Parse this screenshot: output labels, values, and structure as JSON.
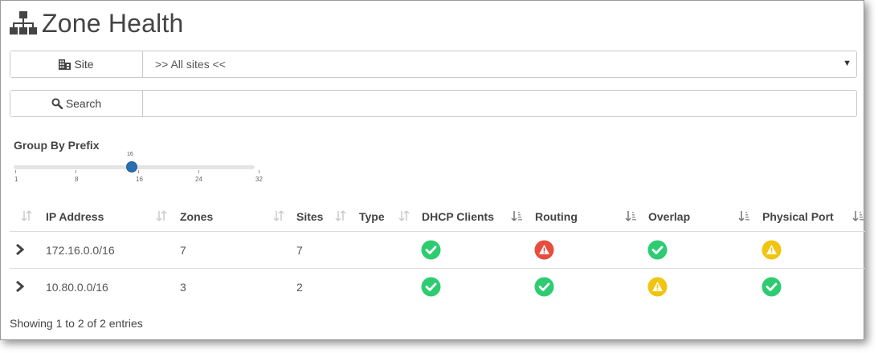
{
  "page": {
    "title": "Zone Health"
  },
  "filters": {
    "site_label": "Site",
    "site_value": ">> All sites <<",
    "search_label": "Search",
    "search_value": ""
  },
  "group_by": {
    "label": "Group By Prefix",
    "value": "16",
    "min": 1,
    "max": 32,
    "ticks": [
      "1",
      "8",
      "16",
      "24",
      "32"
    ]
  },
  "table": {
    "columns": [
      "IP Address",
      "Zones",
      "Sites",
      "Type",
      "DHCP Clients",
      "Routing",
      "Overlap",
      "Physical Port"
    ],
    "rows": [
      {
        "ip": "172.16.0.0/16",
        "zones": "7",
        "sites": "7",
        "type": "",
        "dhcp": "ok",
        "routing": "error",
        "overlap": "ok",
        "physical_port": "warning"
      },
      {
        "ip": "10.80.0.0/16",
        "zones": "3",
        "sites": "2",
        "type": "",
        "dhcp": "ok",
        "routing": "ok",
        "overlap": "warning",
        "physical_port": "ok"
      }
    ]
  },
  "footer": {
    "info": "Showing 1 to 2 of 2 entries"
  },
  "colors": {
    "ok": "#2ecc71",
    "error": "#e74c3c",
    "warning": "#f1c40f",
    "slider": "#2b6fb0"
  },
  "icons": {
    "title": "sitemap-icon",
    "site": "building-icon",
    "search": "search-icon",
    "expand": "chevron-right-icon"
  }
}
